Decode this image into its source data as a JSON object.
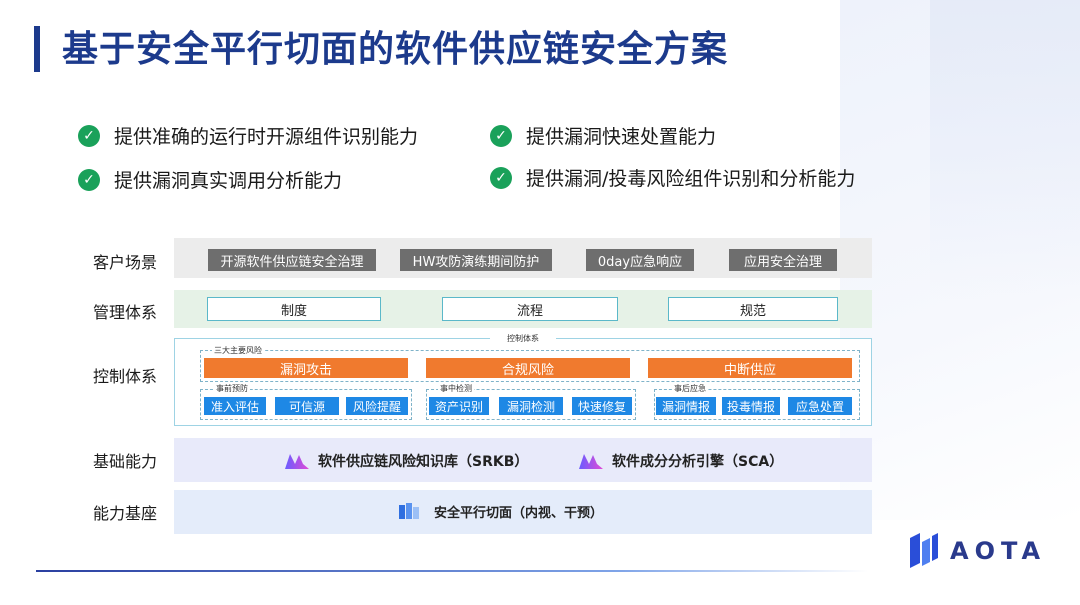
{
  "title": "基于安全平行切面的软件供应链安全方案",
  "features": [
    "提供准确的运行时开源组件识别能力",
    "提供漏洞快速处置能力",
    "提供漏洞真实调用分析能力",
    "提供漏洞/投毒风险组件识别和分析能力"
  ],
  "rows": {
    "scene": "客户场景",
    "mgmt": "管理体系",
    "ctrl": "控制体系",
    "base": "基础能力",
    "found": "能力基座"
  },
  "scenes": [
    "开源软件供应链安全治理",
    "HW攻防演练期间防护",
    "0day应急响应",
    "应用安全治理"
  ],
  "mgmt_items": [
    "制度",
    "流程",
    "规范"
  ],
  "control": {
    "title": "控制体系",
    "risks_label": "三大主要风险",
    "risks": [
      "漏洞攻击",
      "合规风险",
      "中断供应"
    ],
    "phases": [
      "事前预防",
      "事中检测",
      "事后应急"
    ],
    "actions": [
      "准入评估",
      "可信源",
      "风险提醒",
      "资产识别",
      "漏洞检测",
      "快速修复",
      "漏洞情报",
      "投毒情报",
      "应急处置"
    ]
  },
  "base_items": [
    "软件供应链风险知识库（SRKB）",
    "软件成分分析引擎（SCA）"
  ],
  "foundation_item": "安全平行切面（内视、干预）",
  "logo": "AOTA",
  "colors": {
    "title": "#1c3a8c",
    "check": "#1aa15a",
    "risk": "#f07a2e",
    "action": "#1e88e5",
    "scene_tag": "#6e6e6e"
  }
}
